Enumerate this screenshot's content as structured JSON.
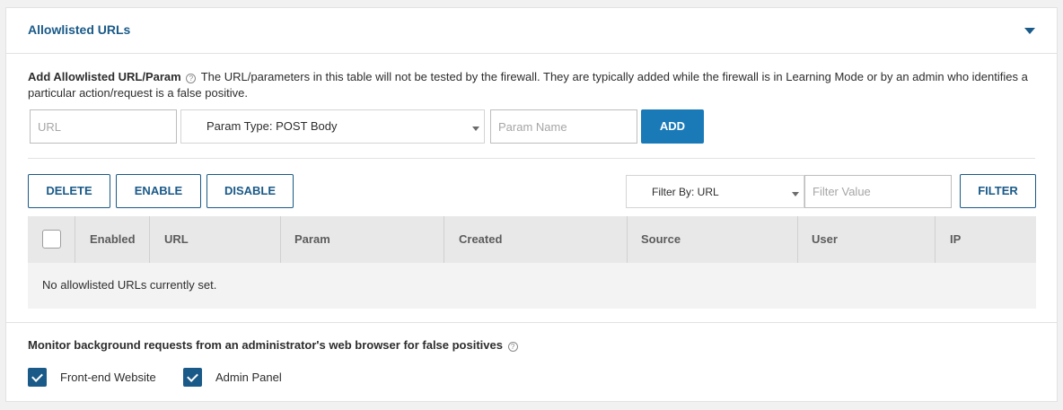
{
  "header": {
    "title": "Allowlisted URLs"
  },
  "add_section": {
    "heading": "Add Allowlisted URL/Param",
    "help_glyph": "?",
    "description": "The URL/parameters in this table will not be tested by the firewall. They are typically added while the firewall is in Learning Mode or by an admin who identifies a particular action/request is a false positive.",
    "url_placeholder": "URL",
    "param_type_label": "Param Type: POST Body",
    "param_name_placeholder": "Param Name",
    "add_label": "ADD"
  },
  "actions": {
    "delete_label": "DELETE",
    "enable_label": "ENABLE",
    "disable_label": "DISABLE",
    "filter_by_label": "Filter By: URL",
    "filter_value_placeholder": "Filter Value",
    "filter_label": "FILTER"
  },
  "table": {
    "columns": [
      "Enabled",
      "URL",
      "Param",
      "Created",
      "Source",
      "User",
      "IP"
    ],
    "empty_message": "No allowlisted URLs currently set."
  },
  "monitor": {
    "title": "Monitor background requests from an administrator's web browser for false positives",
    "help_glyph": "?",
    "options": [
      {
        "label": "Front-end Website",
        "checked": true
      },
      {
        "label": "Admin Panel",
        "checked": true
      }
    ]
  },
  "colors": {
    "accent": "#1a5a88",
    "button_primary": "#1a7ab8"
  }
}
